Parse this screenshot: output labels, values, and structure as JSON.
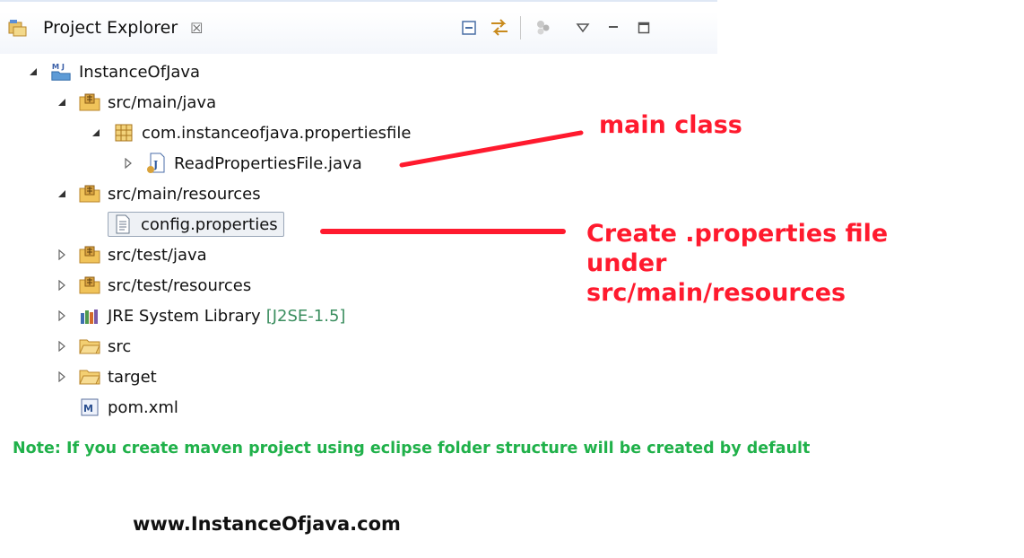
{
  "panel": {
    "title": "Project Explorer",
    "close_glyph": "☒",
    "toolbar": [
      "collapse-all-icon",
      "link-with-editor-icon",
      "filters-icon",
      "view-menu-icon",
      "minimize-icon",
      "maximize-icon"
    ]
  },
  "tree": {
    "items": [
      {
        "label": "InstanceOfJava",
        "icon": "maven-project-icon",
        "expanded": true
      },
      {
        "label": "src/main/java",
        "icon": "source-folder-icon",
        "expanded": true
      },
      {
        "label": "com.instanceofjava.propertiesfile",
        "icon": "package-icon",
        "expanded": true
      },
      {
        "label": "ReadPropertiesFile.java",
        "icon": "java-file-icon",
        "expanded": false
      },
      {
        "label": "src/main/resources",
        "icon": "source-folder-icon",
        "expanded": true
      },
      {
        "label": "config.properties",
        "icon": "text-file-icon",
        "selected": true
      },
      {
        "label": "src/test/java",
        "icon": "source-folder-icon",
        "expanded": false
      },
      {
        "label": "src/test/resources",
        "icon": "source-folder-icon",
        "expanded": false
      },
      {
        "label": "JRE System Library",
        "decoration": "[J2SE-1.5]",
        "icon": "library-icon",
        "expanded": false
      },
      {
        "label": "src",
        "icon": "folder-icon",
        "expanded": false
      },
      {
        "label": "target",
        "icon": "folder-icon",
        "expanded": false
      },
      {
        "label": "pom.xml",
        "icon": "maven-pom-icon"
      }
    ]
  },
  "annotations": {
    "main_class": "main class",
    "create_line1": "Create .properties file",
    "create_line2": "under",
    "create_line3": "src/main/resources",
    "color": "#ff1a2e"
  },
  "note": "Note: If you create maven project using eclipse folder structure will be created by default",
  "note_color": "#20b14a",
  "website": "www.InstanceOfjava.com"
}
